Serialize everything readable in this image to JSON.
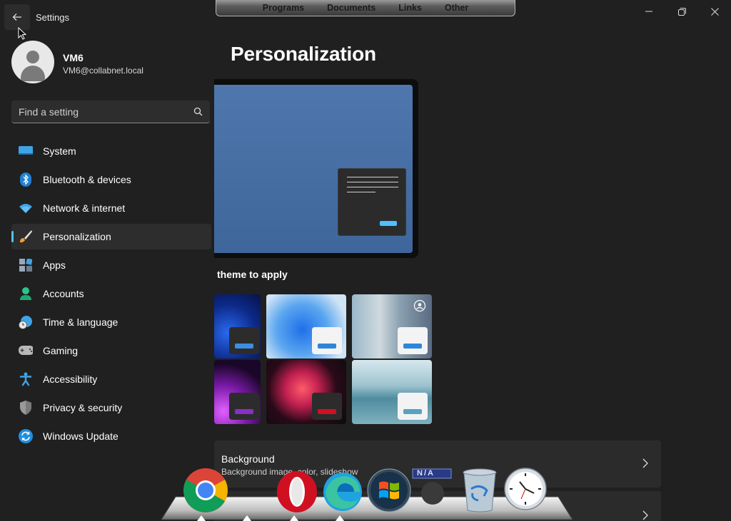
{
  "window": {
    "title": "Settings"
  },
  "top_dock": {
    "tabs": [
      "Programs",
      "Documents",
      "Links",
      "Other"
    ]
  },
  "profile": {
    "name": "VM6",
    "email": "VM6@collabnet.local"
  },
  "search": {
    "placeholder": "Find a setting"
  },
  "nav": {
    "items": [
      {
        "label": "System",
        "icon": "system-icon"
      },
      {
        "label": "Bluetooth & devices",
        "icon": "bluetooth-icon"
      },
      {
        "label": "Network & internet",
        "icon": "wifi-icon"
      },
      {
        "label": "Personalization",
        "icon": "brush-icon",
        "active": true
      },
      {
        "label": "Apps",
        "icon": "apps-icon"
      },
      {
        "label": "Accounts",
        "icon": "accounts-icon"
      },
      {
        "label": "Time & language",
        "icon": "time-language-icon"
      },
      {
        "label": "Gaming",
        "icon": "gamepad-icon"
      },
      {
        "label": "Accessibility",
        "icon": "accessibility-icon"
      },
      {
        "label": "Privacy & security",
        "icon": "shield-icon"
      },
      {
        "label": "Windows Update",
        "icon": "update-icon"
      }
    ]
  },
  "main": {
    "title": "Personalization",
    "theme_section_label": "theme to apply",
    "rows": [
      {
        "title": "Background",
        "subtitle": "Background image, color, slideshow"
      }
    ]
  },
  "dock": {
    "icons": [
      "chrome-icon",
      "opera-icon",
      "edge-icon",
      "windows-icon",
      "na-icon",
      "recycle-bin-icon",
      "clock-icon"
    ],
    "na_label": "N/A"
  },
  "colors": {
    "accent": "#4cc2ff",
    "background": "#202020",
    "card": "#2b2b2b"
  }
}
